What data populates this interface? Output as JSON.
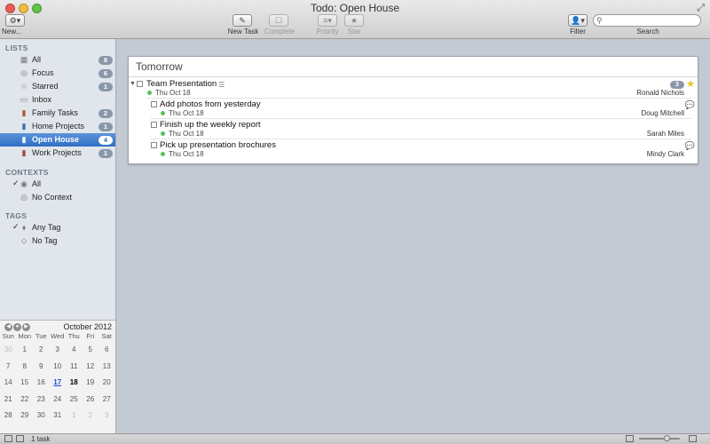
{
  "window": {
    "title": "Todo: Open House"
  },
  "toolbar": {
    "new_label": "New...",
    "new_task_label": "New Task",
    "complete_label": "Complete",
    "priority_label": "Priority",
    "star_label": "Star",
    "filter_label": "Filter",
    "search_label": "Search",
    "search_placeholder": ""
  },
  "sidebar": {
    "lists_header": "LISTS",
    "lists": [
      {
        "label": "All",
        "count": "8",
        "icon": "all-icon"
      },
      {
        "label": "Focus",
        "count": "6",
        "icon": "focus-icon"
      },
      {
        "label": "Starred",
        "count": "1",
        "icon": "star-icon"
      },
      {
        "label": "Inbox",
        "count": "",
        "icon": "inbox-icon"
      },
      {
        "label": "Family Tasks",
        "count": "2",
        "icon": "notebook-icon"
      },
      {
        "label": "Home Projects",
        "count": "1",
        "icon": "notebook-icon"
      },
      {
        "label": "Open House",
        "count": "4",
        "icon": "notebook-icon",
        "selected": true
      },
      {
        "label": "Work Projects",
        "count": "1",
        "icon": "notebook-icon"
      }
    ],
    "contexts_header": "CONTEXTS",
    "contexts": [
      {
        "label": "All",
        "checked": true
      },
      {
        "label": "No Context",
        "checked": false
      }
    ],
    "tags_header": "TAGS",
    "tags": [
      {
        "label": "Any Tag",
        "checked": true
      },
      {
        "label": "No Tag",
        "checked": false
      }
    ]
  },
  "calendar": {
    "month": "October 2012",
    "weekdays": [
      "Sun",
      "Mon",
      "Tue",
      "Wed",
      "Thu",
      "Fri",
      "Sat"
    ],
    "weeks": [
      [
        "30",
        "1",
        "2",
        "3",
        "4",
        "5",
        "6"
      ],
      [
        "7",
        "8",
        "9",
        "10",
        "11",
        "12",
        "13"
      ],
      [
        "14",
        "15",
        "16",
        "17",
        "18",
        "19",
        "20"
      ],
      [
        "21",
        "22",
        "23",
        "24",
        "25",
        "26",
        "27"
      ],
      [
        "28",
        "29",
        "30",
        "31",
        "1",
        "2",
        "3"
      ]
    ],
    "selected_day": "17",
    "today": "18"
  },
  "main": {
    "group_title": "Tomorrow",
    "tasks": [
      {
        "name": "Team Presentation",
        "date": "Thu Oct 18",
        "person": "Ronald Nichols",
        "subtask_count": "3",
        "starred": true,
        "level": 0
      },
      {
        "name": "Add photos from yesterday",
        "date": "Thu Oct 18",
        "person": "Doug Mitchell",
        "has_comment": true,
        "level": 1
      },
      {
        "name": "Finish up the weekly report",
        "date": "Thu Oct 18",
        "person": "Sarah Miles",
        "level": 1
      },
      {
        "name": "Pick up presentation brochures",
        "date": "Thu Oct 18",
        "person": "Mindy Clark",
        "has_comment": true,
        "level": 1
      }
    ]
  },
  "status": {
    "text": "1 task"
  }
}
